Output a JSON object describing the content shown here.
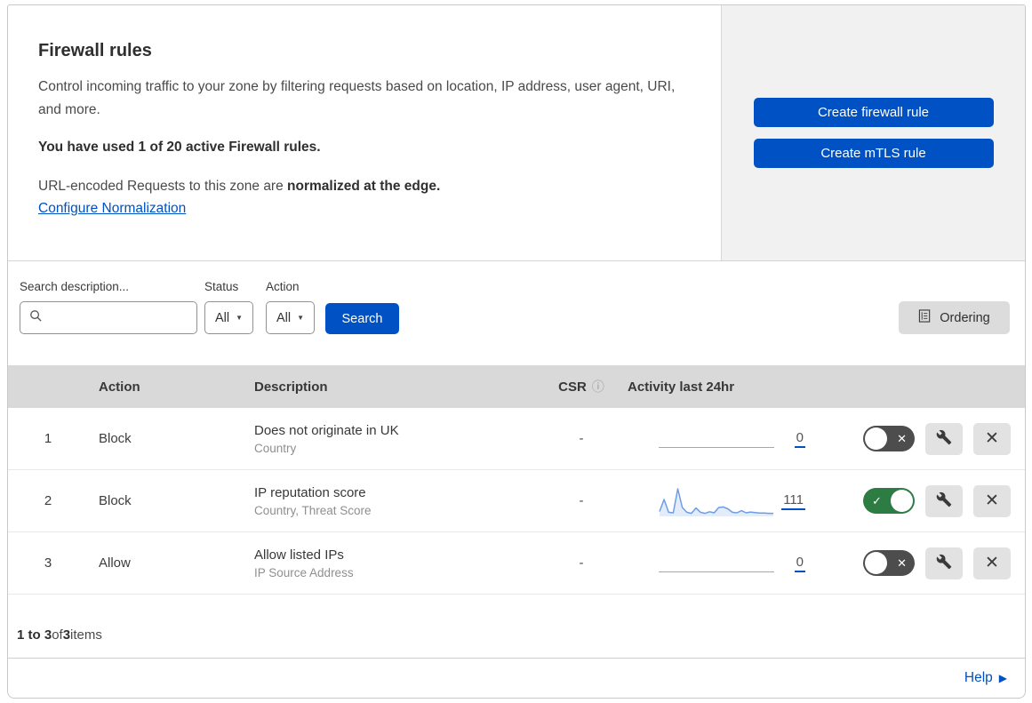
{
  "header": {
    "title": "Firewall rules",
    "description": "Control incoming traffic to your zone by filtering requests based on location, IP address, user agent, URI, and more.",
    "usage": "You have used 1 of 20 active Firewall rules.",
    "normalization_text": "URL-encoded Requests to this zone are ",
    "normalization_bold": "normalized at the edge.",
    "normalization_link": "Configure Normalization",
    "buttons": [
      {
        "label": "Create firewall rule"
      },
      {
        "label": "Create mTLS rule"
      }
    ]
  },
  "filters": {
    "search_label": "Search description...",
    "search_value": "",
    "status_label": "Status",
    "status_value": "All",
    "action_label": "Action",
    "action_value": "All",
    "search_button": "Search",
    "ordering_button": "Ordering"
  },
  "table": {
    "columns": {
      "action": "Action",
      "description": "Description",
      "csr": "CSR",
      "activity": "Activity last 24hr"
    }
  },
  "rows": [
    {
      "priority": "1",
      "action": "Block",
      "description": "Does not originate in UK",
      "criteria": "Country",
      "csr": "-",
      "activity": {
        "count": "0",
        "sparkline": null
      },
      "enabled": false
    },
    {
      "priority": "2",
      "action": "Block",
      "description": "IP reputation score",
      "criteria": "Country, Threat Score",
      "csr": "-",
      "activity": {
        "count": "111",
        "sparkline": [
          15,
          60,
          12,
          10,
          100,
          30,
          12,
          8,
          28,
          12,
          8,
          14,
          10,
          30,
          32,
          25,
          12,
          10,
          18,
          10,
          13,
          11,
          9,
          9,
          8,
          8
        ]
      },
      "enabled": true
    },
    {
      "priority": "3",
      "action": "Allow",
      "description": "Allow listed IPs",
      "criteria": "IP Source Address",
      "csr": "-",
      "activity": {
        "count": "0",
        "sparkline": null
      },
      "enabled": false
    }
  ],
  "footer": {
    "range_bold": "1 to 3",
    "of_text": " of ",
    "total_bold": "3",
    "items_text": " items",
    "help": "Help"
  },
  "colors": {
    "accent": "#0051c3",
    "toggle_on": "#2c7c43",
    "toggle_off": "#4d4d4d",
    "sparkline_line": "#6f9ce6",
    "sparkline_fill": "#e3edf9",
    "table_header_bg": "#d9d9d9",
    "panel_bg": "#f1f1f1"
  }
}
